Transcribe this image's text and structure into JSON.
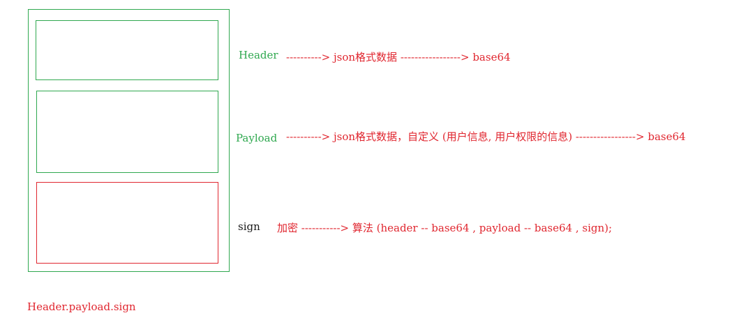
{
  "labels": {
    "header": "Header",
    "payload": "Payload",
    "sign": "sign",
    "footer": "Header.payload.sign"
  },
  "flows": {
    "header": "----------> json格式数据 -----------------> base64",
    "payload": "----------> json格式数据，自定义 (用户信息, 用户权限的信息) -----------------> base64",
    "sign": "加密 -----------> 算法 (header -- base64  , payload -- base64 , sign);"
  },
  "colors": {
    "green": "#2fa84f",
    "red": "#e0262f"
  }
}
